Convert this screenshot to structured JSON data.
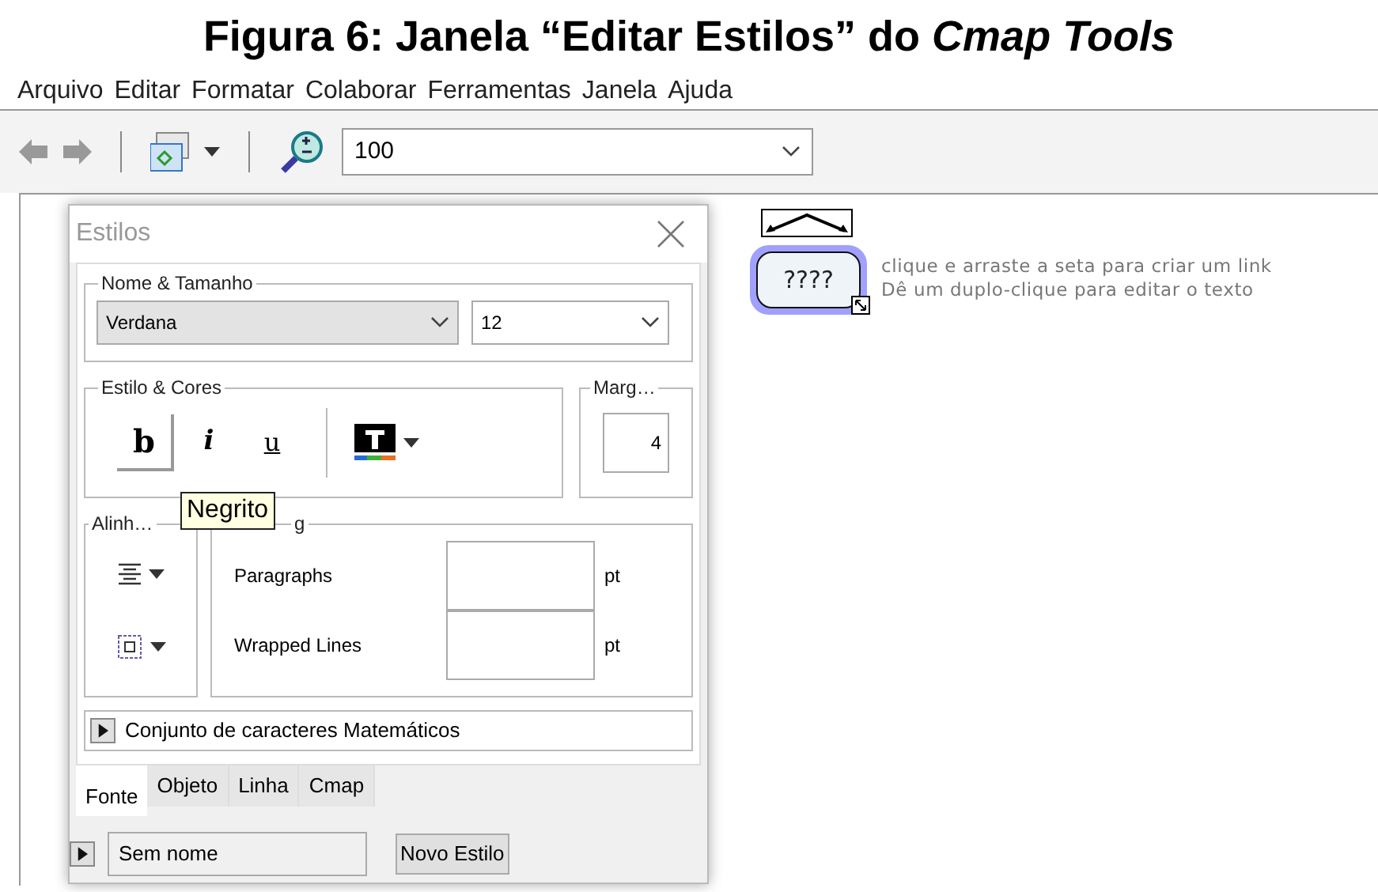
{
  "caption": "Figura 6: Janela “Editar Estilos” do *Cmap Tools*",
  "menu": [
    "Arquivo",
    "Editar",
    "Formatar",
    "Colaborar",
    "Ferramentas",
    "Janela",
    "Ajuda"
  ],
  "toolbar": {
    "zoom": "100"
  },
  "dialog": {
    "title": "Estilos",
    "font_group": {
      "label": "Nome & Tamanho",
      "font": "Verdana",
      "size": "12"
    },
    "style_group": {
      "label": "Estilo & Cores",
      "buttons": [
        {
          "kind": "bold",
          "label": "b",
          "selected": true
        },
        {
          "kind": "italic",
          "label": "i",
          "selected": false
        },
        {
          "kind": "underline",
          "label": "u",
          "selected": false
        }
      ]
    },
    "margin_group": {
      "label": "Marg…",
      "value": "4"
    },
    "align_group": {
      "label": "Alinh…"
    },
    "spacing_group": {
      "label": "g",
      "rows": [
        {
          "label": "Paragraphs",
          "unit": "pt"
        },
        {
          "label": "Wrapped Lines",
          "unit": "pt"
        }
      ]
    },
    "charset": {
      "label": "Conjunto de caracteres Matemáticos",
      "expanded": false
    },
    "tabs": [
      {
        "label": "Fonte",
        "selected": true
      },
      {
        "label": "Objeto",
        "selected": false
      },
      {
        "label": "Linha",
        "selected": false
      },
      {
        "label": "Cmap",
        "selected": false
      }
    ],
    "footer": {
      "style_name": "Sem nome",
      "button": "Novo Estilo"
    },
    "tooltip": "Negrito"
  },
  "node": {
    "label": "????",
    "selected": true,
    "hints": [
      "clique e arraste a seta para criar um link",
      "Dê um duplo-clique para editar o texto"
    ]
  }
}
